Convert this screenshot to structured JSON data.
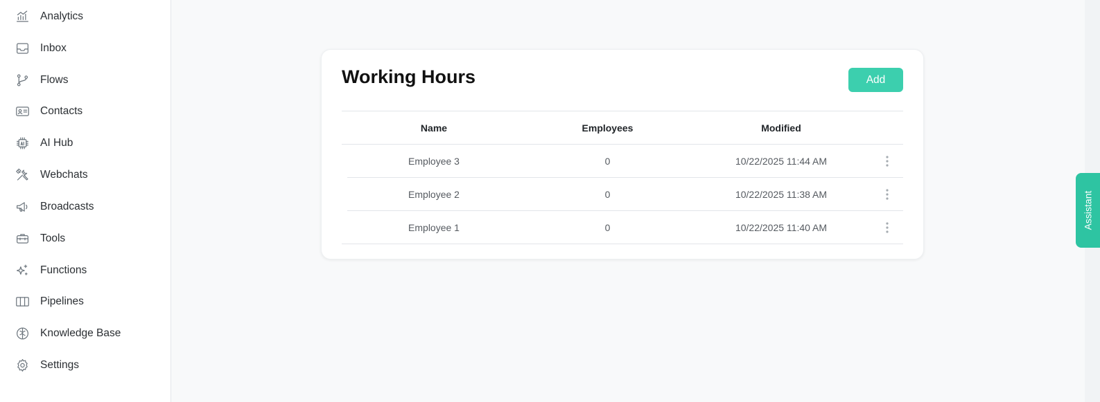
{
  "sidebar": {
    "items": [
      {
        "label": "Analytics",
        "icon": "analytics-icon"
      },
      {
        "label": "Inbox",
        "icon": "inbox-icon"
      },
      {
        "label": "Flows",
        "icon": "flows-icon"
      },
      {
        "label": "Contacts",
        "icon": "contacts-icon"
      },
      {
        "label": "AI Hub",
        "icon": "ai-chip-icon"
      },
      {
        "label": "Webchats",
        "icon": "webchat-tools-icon"
      },
      {
        "label": "Broadcasts",
        "icon": "megaphone-icon"
      },
      {
        "label": "Tools",
        "icon": "toolbox-icon"
      },
      {
        "label": "Functions",
        "icon": "sparkles-icon"
      },
      {
        "label": "Pipelines",
        "icon": "columns-icon"
      },
      {
        "label": "Knowledge Base",
        "icon": "brain-icon"
      },
      {
        "label": "Settings",
        "icon": "gear-icon"
      }
    ]
  },
  "card": {
    "title": "Working Hours",
    "add_label": "Add"
  },
  "table": {
    "columns": [
      "Name",
      "Employees",
      "Modified"
    ],
    "rows": [
      {
        "name": "Employee 3",
        "employees": "0",
        "modified": "10/22/2025 11:44 AM"
      },
      {
        "name": "Employee 2",
        "employees": "0",
        "modified": "10/22/2025 11:38 AM"
      },
      {
        "name": "Employee 1",
        "employees": "0",
        "modified": "10/22/2025 11:40 AM"
      }
    ]
  },
  "assistant": {
    "label": "Assistant"
  },
  "colors": {
    "accent": "#3ccfae",
    "assistant": "#2ec4a2",
    "background": "#f8f9fa"
  }
}
